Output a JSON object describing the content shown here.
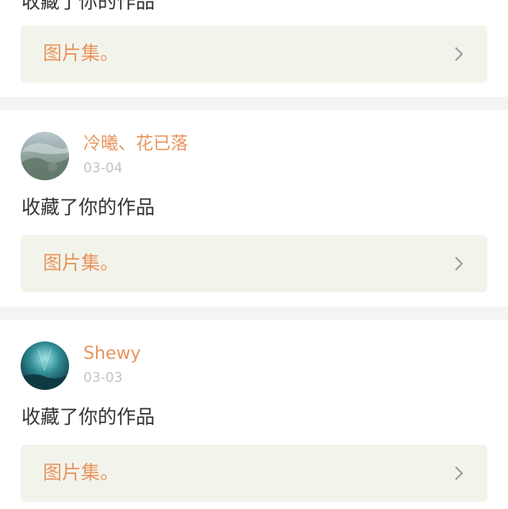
{
  "feed": {
    "top_item": {
      "action": "收藏了你的作品",
      "album_label": "图片集。"
    },
    "items": [
      {
        "username": "冷曦、花已落",
        "date": "03-04",
        "action": "收藏了你的作品",
        "album_label": "图片集。",
        "avatar_icon": "avatar-landscape-image"
      },
      {
        "username": "Shewy",
        "date": "03-03",
        "action": "收藏了你的作品",
        "album_label": "图片集。",
        "avatar_icon": "avatar-underwater-image"
      }
    ],
    "chevron_icon": "chevron-right-icon"
  },
  "colors": {
    "accent": "#e8955e",
    "muted": "#c4c4c4",
    "text": "#333333",
    "album_bg": "#f2f4ec",
    "separator": "#f4f4f4"
  }
}
